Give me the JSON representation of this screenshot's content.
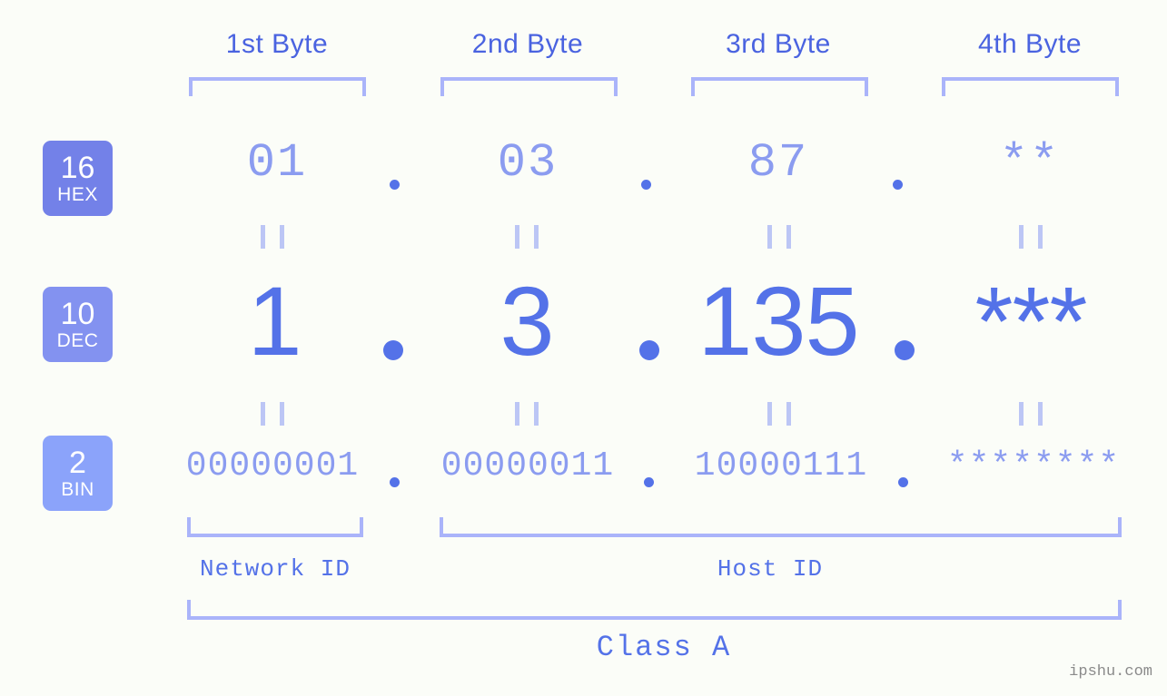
{
  "background_color": "#fbfdf8",
  "accent_colors": {
    "strong_blue": "#5472e8",
    "label_blue": "#4a63e0",
    "light_periwinkle": "#8b9cf0",
    "bracket": "#aab4fa",
    "eq_mark": "#bcc6f5",
    "badge_hex": "#7381e8",
    "badge_dec": "#8392f0",
    "badge_bin": "#8ba3fa",
    "watermark": "#8a8a8a"
  },
  "byte_headers": [
    {
      "label": "1st Byte"
    },
    {
      "label": "2nd Byte"
    },
    {
      "label": "3rd Byte"
    },
    {
      "label": "4th Byte"
    }
  ],
  "bases": [
    {
      "number": "16",
      "name": "HEX"
    },
    {
      "number": "10",
      "name": "DEC"
    },
    {
      "number": "2",
      "name": "BIN"
    }
  ],
  "rows": {
    "hex": {
      "base_number": "16",
      "base_name": "HEX",
      "values": [
        "01",
        "03",
        "87",
        "**"
      ],
      "separator": "."
    },
    "dec": {
      "base_number": "10",
      "base_name": "DEC",
      "values": [
        "1",
        "3",
        "135",
        "***"
      ],
      "separator": "."
    },
    "bin": {
      "base_number": "2",
      "base_name": "BIN",
      "values": [
        "00000001",
        "00000011",
        "10000111",
        "********"
      ],
      "separator": "."
    }
  },
  "equality_symbol": "=",
  "sections": {
    "network_id": "Network ID",
    "host_id": "Host ID",
    "class": "Class A"
  },
  "watermark": "ipshu.com"
}
